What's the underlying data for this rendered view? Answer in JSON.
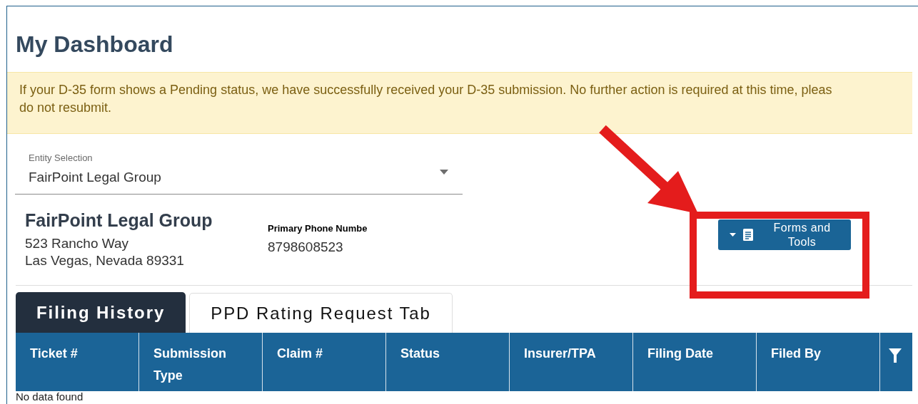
{
  "page": {
    "title": "My Dashboard"
  },
  "notice": {
    "lines": [
      "If your D-35 form shows a Pending status, we have successfully received your D-35 submission. No further action is required at this time, pleas",
      "do not resubmit."
    ]
  },
  "entity_selection": {
    "label": "Entity Selection",
    "value": "FairPoint Legal Group"
  },
  "entity": {
    "name": "FairPoint Legal Group",
    "address_lines": [
      "523 Rancho Way",
      "Las Vegas, Nevada 89331"
    ],
    "phone_label": "Primary Phone Numbe",
    "phone": "8798608523"
  },
  "forms_button": {
    "label": "Forms and Tools"
  },
  "tabs": [
    {
      "label": "Filing History",
      "selected": true
    },
    {
      "label": "PPD Rating Request Tab",
      "selected": false
    }
  ],
  "table": {
    "columns": [
      "Ticket #",
      "Submission Type",
      "Claim #",
      "Status",
      "Insurer/TPA",
      "Filing Date",
      "Filed By"
    ],
    "empty_message": "No data found"
  }
}
